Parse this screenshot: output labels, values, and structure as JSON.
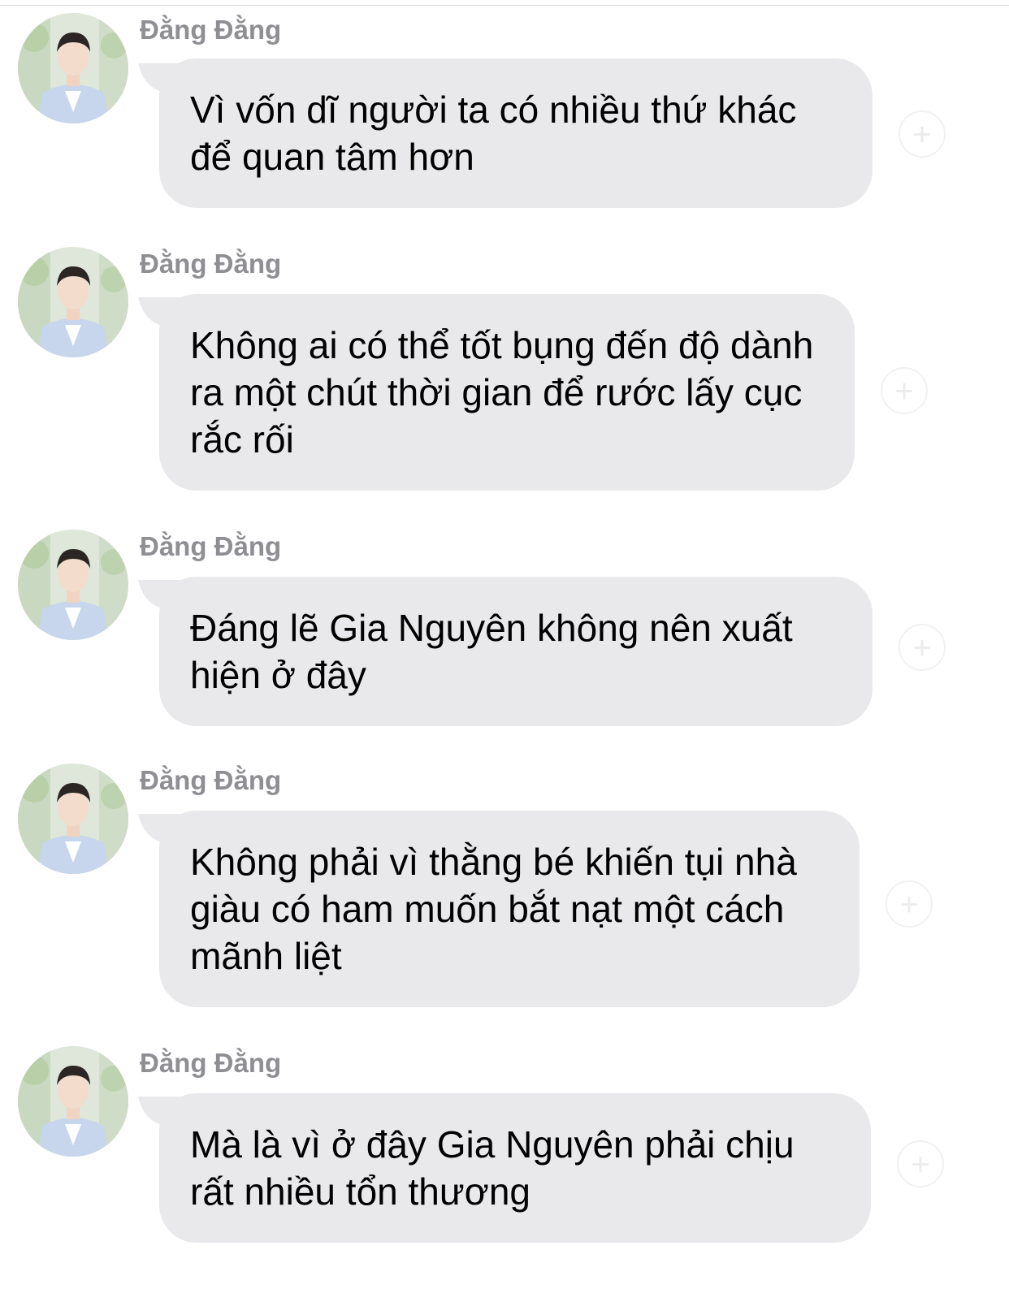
{
  "messages": [
    {
      "sender": "Đằng Đằng",
      "text": "Vì vốn dĩ người ta có nhiều thứ khác để quan tâm hơn"
    },
    {
      "sender": "Đằng Đằng",
      "text": "Không ai có thể tốt bụng đến độ dành ra một chút thời gian để rước lấy cục rắc rối"
    },
    {
      "sender": "Đằng Đằng",
      "text": "Đáng lẽ Gia Nguyên không nên xuất hiện ở đây"
    },
    {
      "sender": "Đằng Đằng",
      "text": "Không phải vì thằng bé khiến tụi nhà giàu có ham muốn bắt nạt một cách mãnh liệt"
    },
    {
      "sender": "Đằng Đằng",
      "text": "Mà là vì ở đây Gia Nguyên phải chịu rất nhiều tổn thương"
    }
  ],
  "icons": {
    "avatar": "profile-photo",
    "reaction": "plus-circle-icon"
  },
  "colors": {
    "bubble": "#e9e9eb",
    "sender": "#8e8e93",
    "text": "#000000",
    "background": "#ffffff"
  }
}
